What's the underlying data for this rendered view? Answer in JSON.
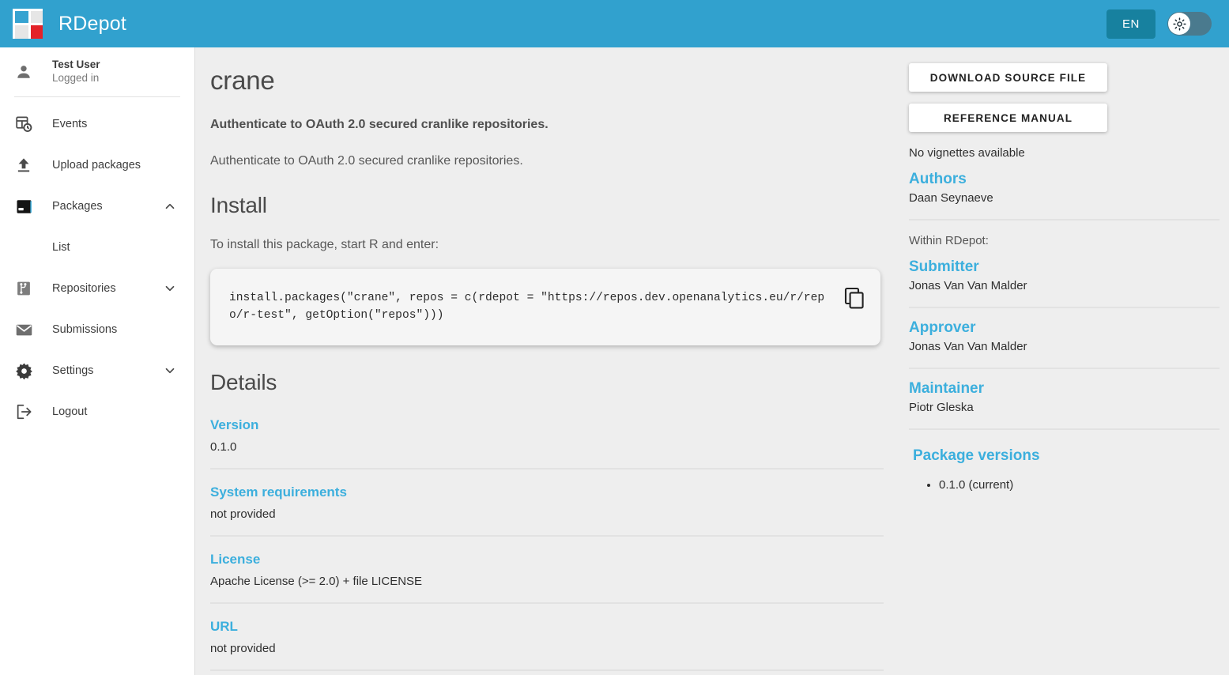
{
  "app": {
    "brand": "RDepot",
    "logo_icon": "rdepot-logo",
    "lang_button": "EN",
    "theme_toggle_icon": "sun-icon",
    "accent_blue": "#31a1ce",
    "link_blue": "#3cafdd",
    "lang_button_bg": "#17819f",
    "toggle_track": "#4a7a8e",
    "content_bg": "#eeeeee"
  },
  "sidebar": {
    "user": {
      "icon": "person-icon",
      "name": "Test User",
      "status": "Logged in"
    },
    "items": [
      {
        "label": "Events",
        "icon": "events-icon",
        "chevron": ""
      },
      {
        "label": "Upload packages",
        "icon": "upload-icon",
        "chevron": ""
      },
      {
        "label": "Packages",
        "icon": "packages-icon",
        "chevron": "chevron-up-icon",
        "active": true
      },
      {
        "label": "Repositories",
        "icon": "repositories-icon",
        "chevron": "chevron-down-icon"
      },
      {
        "label": "Submissions",
        "icon": "submissions-icon",
        "chevron": ""
      },
      {
        "label": "Settings",
        "icon": "settings-gear-icon",
        "chevron": "chevron-down-icon"
      },
      {
        "label": "Logout",
        "icon": "logout-icon",
        "chevron": ""
      }
    ],
    "sub_items": [
      {
        "label": "List",
        "parent": "Packages"
      }
    ]
  },
  "main": {
    "package_name": "crane",
    "short_description": "Authenticate to OAuth 2.0 secured cranlike repositories.",
    "description": "Authenticate to OAuth 2.0 secured cranlike repositories.",
    "install_heading": "Install",
    "install_hint": "To install this package, start R and enter:",
    "install_code": "install.packages(\"crane\", repos = c(rdepot = \"https://repos.dev.openanalytics.eu/r/repo/r-test\", getOption(\"repos\")))",
    "copy_icon": "copy-icon",
    "details_heading": "Details",
    "details": [
      {
        "key": "Version",
        "value": "0.1.0"
      },
      {
        "key": "System requirements",
        "value": "not provided"
      },
      {
        "key": "License",
        "value": "Apache License (>= 2.0) + file LICENSE"
      },
      {
        "key": "URL",
        "value": "not provided"
      }
    ]
  },
  "side": {
    "download_button": "DOWNLOAD SOURCE FILE",
    "manual_button": "REFERENCE MANUAL",
    "vignettes_note": "No vignettes available",
    "authors_label": "Authors",
    "authors_value": "Daan Seynaeve",
    "within_label": "Within RDepot:",
    "submitter_label": "Submitter",
    "submitter_value": "Jonas Van Van Malder",
    "approver_label": "Approver",
    "approver_value": "Jonas Van Van Malder",
    "maintainer_label": "Maintainer",
    "maintainer_value": "Piotr Gleska",
    "versions_label": "Package versions",
    "versions": [
      "0.1.0 (current)"
    ]
  }
}
